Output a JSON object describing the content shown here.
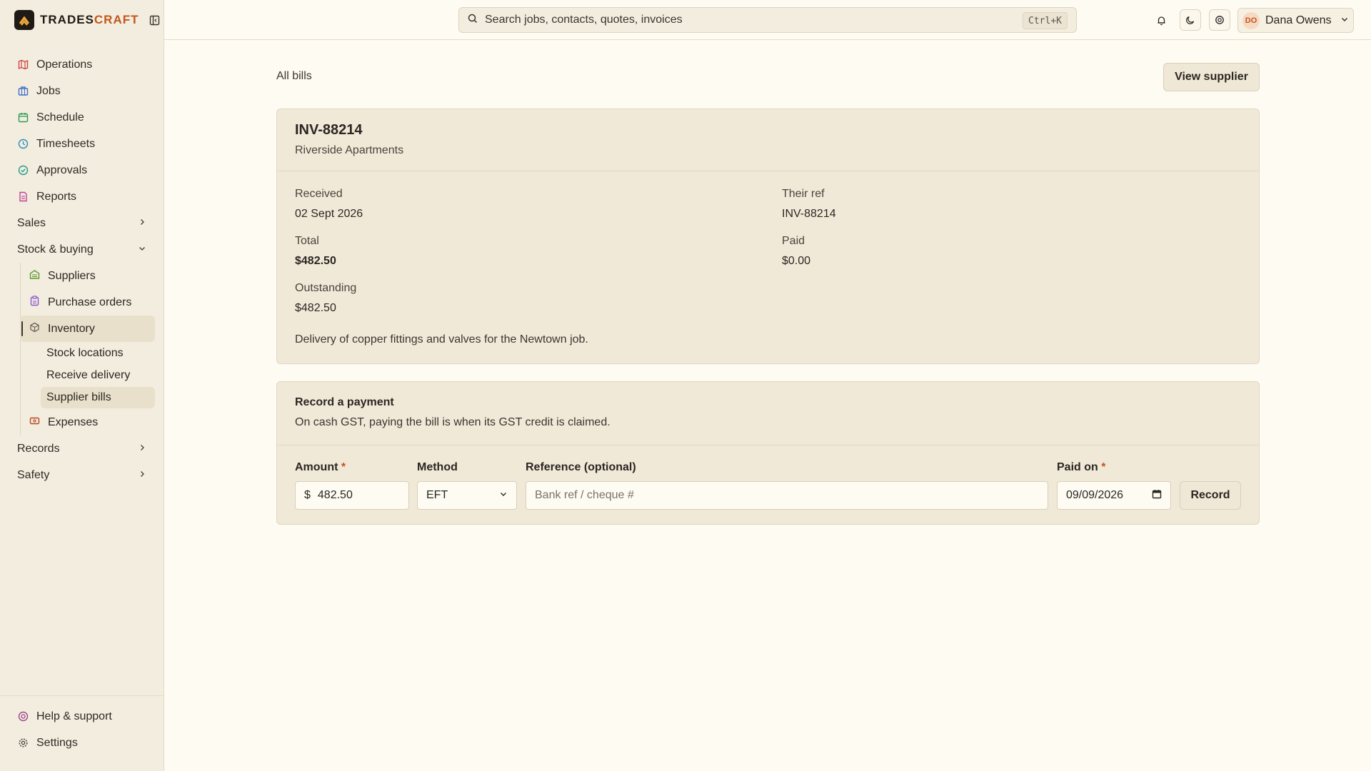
{
  "brand": {
    "name_main": "TRADES",
    "name_accent": "CRAFT"
  },
  "nav": {
    "items": [
      {
        "label": "Operations",
        "icon": "map-icon"
      },
      {
        "label": "Jobs",
        "icon": "briefcase-icon"
      },
      {
        "label": "Schedule",
        "icon": "calendar-icon"
      },
      {
        "label": "Timesheets",
        "icon": "clock-icon"
      },
      {
        "label": "Approvals",
        "icon": "check-circle-icon"
      },
      {
        "label": "Reports",
        "icon": "report-icon"
      }
    ],
    "sales": "Sales",
    "stock": "Stock & buying",
    "stock_items": {
      "suppliers": "Suppliers",
      "purchase_orders": "Purchase orders",
      "inventory": "Inventory",
      "stock_locations": "Stock locations",
      "receive_delivery": "Receive delivery",
      "supplier_bills": "Supplier bills",
      "expenses": "Expenses"
    },
    "records": "Records",
    "safety": "Safety",
    "help": "Help & support",
    "settings": "Settings"
  },
  "topbar": {
    "search_placeholder": "Search jobs, contacts, quotes, invoices",
    "shortcut": "Ctrl+K",
    "user_initials": "DO",
    "user_name": "Dana Owens"
  },
  "page": {
    "breadcrumb": "All bills",
    "view_supplier": "View supplier"
  },
  "bill": {
    "number": "INV-88214",
    "customer": "Riverside Apartments",
    "received_label": "Received",
    "received": "02 Sept 2026",
    "their_ref_label": "Their ref",
    "their_ref": "INV-88214",
    "total_label": "Total",
    "total": "$482.50",
    "paid_label": "Paid",
    "paid": "$0.00",
    "outstanding_label": "Outstanding",
    "outstanding": "$482.50",
    "description": "Delivery of copper fittings and valves for the Newtown job."
  },
  "payment": {
    "title": "Record a payment",
    "subtitle": "On cash GST, paying the bill is when its GST credit is claimed.",
    "amount_label": "Amount",
    "currency": "$",
    "amount": "482.50",
    "method_label": "Method",
    "method": "EFT",
    "reference_label": "Reference (optional)",
    "reference_placeholder": "Bank ref / cheque #",
    "paid_on_label": "Paid on",
    "paid_on": "09/09/2026",
    "record": "Record",
    "required_mark": "*"
  },
  "colors": {
    "accent": "#c2571d",
    "background": "#fefbf3",
    "sidebar": "#f3eddf",
    "card": "#f1e9d8"
  }
}
